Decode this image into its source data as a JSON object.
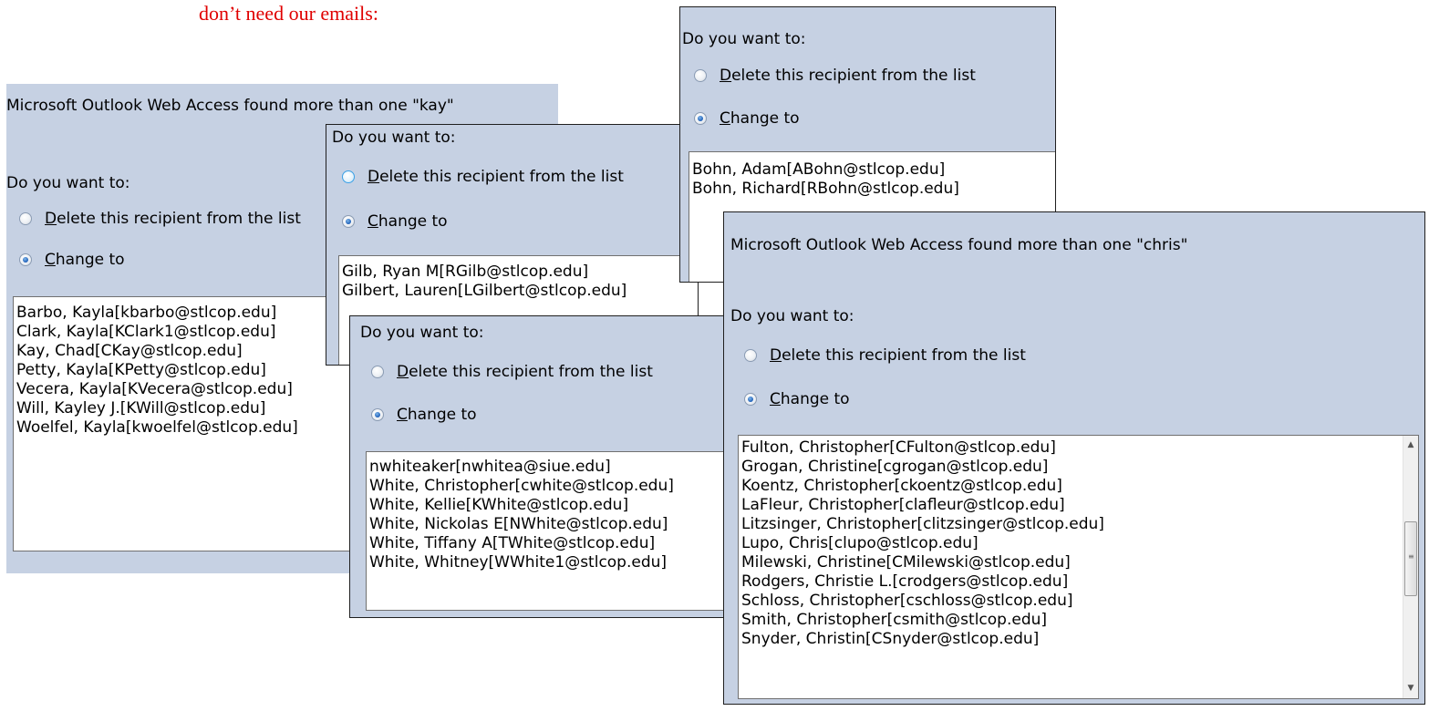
{
  "caption": "don’t need our emails:",
  "dialog_kay": {
    "found_message": "Microsoft Outlook Web Access found more than one \"kay\"",
    "prompt": "Do you want to:",
    "delete_option": {
      "accel": "D",
      "rest": "elete this recipient from the list"
    },
    "change_option": {
      "accel": "C",
      "rest": "hange to"
    },
    "list": [
      "Barbo, Kayla[kbarbo@stlcop.edu]",
      "Clark, Kayla[KClark1@stlcop.edu]",
      "Kay, Chad[CKay@stlcop.edu]",
      "Petty, Kayla[KPetty@stlcop.edu]",
      "Vecera, Kayla[KVecera@stlcop.edu]",
      "Will, Kayley J.[KWill@stlcop.edu]",
      "Woelfel, Kayla[kwoelfel@stlcop.edu]"
    ]
  },
  "dialog_gilb": {
    "prompt": "Do you want to:",
    "delete_option": {
      "accel": "D",
      "rest": "elete this recipient from the list"
    },
    "change_option": {
      "accel": "C",
      "rest": "hange to"
    },
    "list": [
      "Gilb, Ryan M[RGilb@stlcop.edu]",
      "Gilbert, Lauren[LGilbert@stlcop.edu]"
    ]
  },
  "dialog_bohn": {
    "prompt": "Do you want to:",
    "delete_option": {
      "accel": "D",
      "rest": "elete this recipient from the list"
    },
    "change_option": {
      "accel": "C",
      "rest": "hange to"
    },
    "list": [
      "Bohn, Adam[ABohn@stlcop.edu]",
      "Bohn, Richard[RBohn@stlcop.edu]"
    ]
  },
  "dialog_white": {
    "prompt": "Do you want to:",
    "delete_option": {
      "accel": "D",
      "rest": "elete this recipient from the list"
    },
    "change_option": {
      "accel": "C",
      "rest": "hange to"
    },
    "list": [
      "nwhiteaker[nwhitea@siue.edu]",
      "White, Christopher[cwhite@stlcop.edu]",
      "White, Kellie[KWhite@stlcop.edu]",
      "White, Nickolas E[NWhite@stlcop.edu]",
      "White, Tiffany A[TWhite@stlcop.edu]",
      "White, Whitney[WWhite1@stlcop.edu]"
    ]
  },
  "dialog_chris": {
    "found_message": "Microsoft Outlook Web Access found more than one \"chris\"",
    "prompt": "Do you want to:",
    "delete_option": {
      "accel": "D",
      "rest": "elete this recipient from the list"
    },
    "change_option": {
      "accel": "C",
      "rest": "hange to"
    },
    "list": [
      "Fulton, Christopher[CFulton@stlcop.edu]",
      "Grogan, Christine[cgrogan@stlcop.edu]",
      "Koentz, Christopher[ckoentz@stlcop.edu]",
      "LaFleur, Christopher[clafleur@stlcop.edu]",
      "Litzsinger, Christopher[clitzsinger@stlcop.edu]",
      "Lupo, Chris[clupo@stlcop.edu]",
      "Milewski, Christine[CMilewski@stlcop.edu]",
      "Rodgers, Christie L.[crodgers@stlcop.edu]",
      "Schloss, Christopher[cschloss@stlcop.edu]",
      "Smith, Christopher[csmith@stlcop.edu]",
      "Snyder, Christin[CSnyder@stlcop.edu]"
    ],
    "scroll_up_glyph": "▲",
    "scroll_down_glyph": "▼",
    "grip_glyph": "≡"
  }
}
